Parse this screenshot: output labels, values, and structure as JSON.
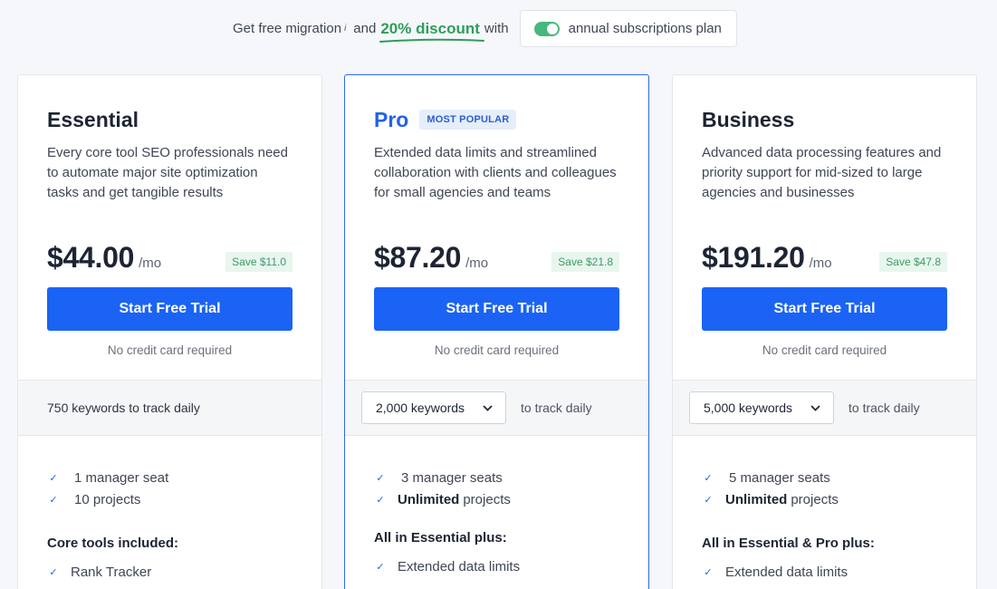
{
  "promo": {
    "prefix": "Get free migration",
    "sup": "i",
    "connector": "and",
    "discount": "20% discount",
    "suffix": "with",
    "toggle_label": "annual subscriptions plan",
    "toggle_on": true
  },
  "colors": {
    "primary": "#1b63f5",
    "pro_title": "#2262e8",
    "discount_green": "#2e9d5b",
    "toggle_green": "#45b97c"
  },
  "plans": [
    {
      "name": "Essential",
      "description": "Every core tool SEO professionals need to automate major site optimization tasks and get tangible results",
      "price": "$44.00",
      "per": "/mo",
      "save": "Save $11.0",
      "cta": "Start Free Trial",
      "no_card": "No credit card required",
      "keywords_text": "750 keywords",
      "keywords_suffix": "to track daily",
      "features": [
        {
          "bold": "",
          "text": "1 manager seat"
        },
        {
          "bold": "",
          "text": "10 projects"
        }
      ],
      "section_heading": "Core tools included:",
      "section_items": [
        "Rank Tracker"
      ]
    },
    {
      "name": "Pro",
      "badge": "MOST POPULAR",
      "description": "Extended data limits and streamlined collaboration with clients and colleagues for small agencies and teams",
      "price": "$87.20",
      "per": "/mo",
      "save": "Save $21.8",
      "cta": "Start Free Trial",
      "no_card": "No credit card required",
      "keywords_select": "2,000 keywords",
      "keywords_suffix": "to track daily",
      "features": [
        {
          "bold": "",
          "text": "3 manager seats"
        },
        {
          "bold": "Unlimited",
          "text": "projects"
        }
      ],
      "section_heading": "All in Essential plus:",
      "section_items": [
        "Extended data limits"
      ]
    },
    {
      "name": "Business",
      "description": "Advanced data processing features and priority support for mid-sized to large agencies and businesses",
      "price": "$191.20",
      "per": "/mo",
      "save": "Save $47.8",
      "cta": "Start Free Trial",
      "no_card": "No credit card required",
      "keywords_select": "5,000 keywords",
      "keywords_suffix": "to track daily",
      "features": [
        {
          "bold": "",
          "text": "5 manager seats"
        },
        {
          "bold": "Unlimited",
          "text": "projects"
        }
      ],
      "section_heading": "All in Essential & Pro plus:",
      "section_items": [
        "Extended data limits"
      ]
    }
  ]
}
